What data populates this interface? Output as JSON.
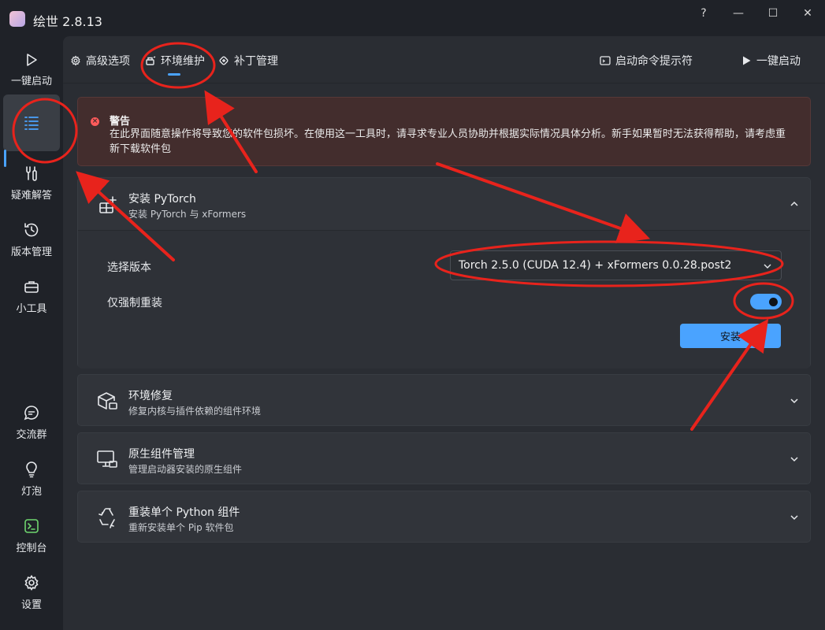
{
  "app": {
    "title": "绘世 2.8.13"
  },
  "window_controls": {
    "help": "?",
    "minimize": "—",
    "maximize": "☐",
    "close": "✕"
  },
  "sidebar": {
    "items": [
      {
        "label": "一键启动",
        "icon": "play-icon"
      },
      {
        "label": "",
        "icon": "list-icon",
        "active": true
      },
      {
        "label": "疑难解答",
        "icon": "wrench-icon"
      },
      {
        "label": "版本管理",
        "icon": "history-icon"
      },
      {
        "label": "小工具",
        "icon": "toolbox-icon"
      }
    ],
    "bottom_items": [
      {
        "label": "交流群",
        "icon": "chat-icon"
      },
      {
        "label": "灯泡",
        "icon": "lightbulb-icon"
      },
      {
        "label": "控制台",
        "icon": "console-icon"
      },
      {
        "label": "设置",
        "icon": "gear-icon"
      }
    ]
  },
  "tabs": [
    {
      "label": "高级选项",
      "icon": "gear-icon"
    },
    {
      "label": "环境维护",
      "icon": "maintenance-icon",
      "active": true
    },
    {
      "label": "补丁管理",
      "icon": "patch-icon"
    }
  ],
  "actions": {
    "console_prompt": "启动命令提示符",
    "launch": "一键启动"
  },
  "warning": {
    "title": "警告",
    "body": "在此界面随意操作将导致您的软件包损坏。在使用这一工具时，请寻求专业人员协助并根据实际情况具体分析。新手如果暂时无法获得帮助，请考虑重新下载软件包"
  },
  "cards": [
    {
      "title": "安装 PyTorch",
      "subtitle": "安装 PyTorch 与 xFormers",
      "icon": "package-add-icon",
      "expanded": true,
      "version_label": "选择版本",
      "version_value": "Torch 2.5.0 (CUDA 12.4) + xFormers 0.0.28.post2",
      "force_label": "仅强制重装",
      "force_on": true,
      "install_button": "安装"
    },
    {
      "title": "环境修复",
      "subtitle": "修复内核与插件依赖的组件环境",
      "icon": "box-repair-icon"
    },
    {
      "title": "原生组件管理",
      "subtitle": "管理启动器安装的原生组件",
      "icon": "monitor-component-icon"
    },
    {
      "title": "重装单个 Python 组件",
      "subtitle": "重新安装单个 Pip 软件包",
      "icon": "recycle-icon"
    }
  ],
  "colors": {
    "accent": "#4aa3ff",
    "annotation": "#e8231c",
    "warning_bg": "#432d2d"
  }
}
